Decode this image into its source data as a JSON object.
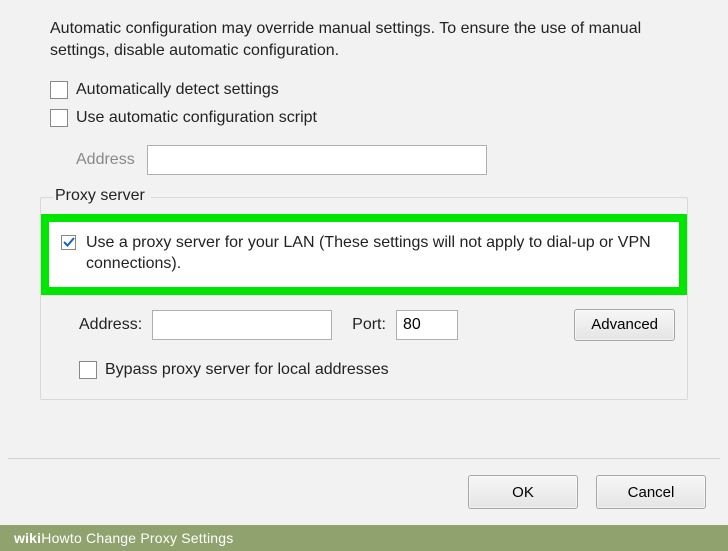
{
  "autoConfig": {
    "info": "Automatic configuration may override manual settings.  To ensure the use of manual settings, disable automatic configuration.",
    "autoDetectLabel": "Automatically detect settings",
    "autoDetectChecked": false,
    "useScriptLabel": "Use automatic configuration script",
    "useScriptChecked": false,
    "addressLabel": "Address",
    "addressValue": ""
  },
  "proxy": {
    "legend": "Proxy server",
    "useProxyLabel": "Use a proxy server for your LAN (These settings will not apply to dial-up or VPN connections).",
    "useProxyChecked": true,
    "addressLabel": "Address:",
    "addressValue": "",
    "portLabel": "Port:",
    "portValue": "80",
    "advancedLabel": "Advanced",
    "bypassLabel": "Bypass proxy server for local addresses",
    "bypassChecked": false
  },
  "buttons": {
    "ok": "OK",
    "cancel": "Cancel"
  },
  "watermark": {
    "brand1": "wiki",
    "brand2": "How",
    "caption": " to Change Proxy Settings"
  }
}
